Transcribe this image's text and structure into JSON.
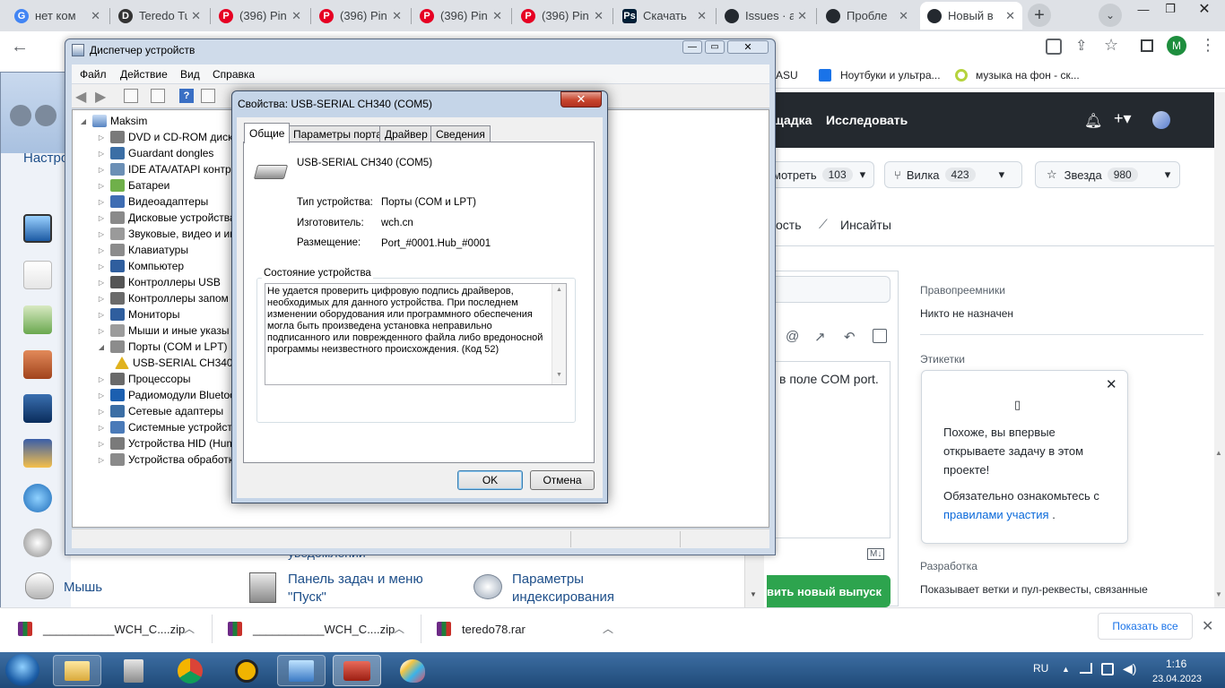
{
  "browser": {
    "tabs": [
      {
        "label": "нет ком",
        "fav": "G",
        "color": "#4285f4"
      },
      {
        "label": "Teredo Tu",
        "fav": "D",
        "color": "#333333"
      },
      {
        "label": "(396) Pin",
        "fav": "P",
        "color": "#e60023"
      },
      {
        "label": "(396) Pin",
        "fav": "P",
        "color": "#e60023"
      },
      {
        "label": "(396) Pin",
        "fav": "P",
        "color": "#e60023"
      },
      {
        "label": "(396) Pin",
        "fav": "P",
        "color": "#e60023"
      },
      {
        "label": "Скачать",
        "fav": "Ps",
        "color": "#001e36"
      },
      {
        "label": "Issues · a",
        "fav": "",
        "color": "#24292f"
      },
      {
        "label": "Пробле",
        "fav": "",
        "color": "#24292f"
      },
      {
        "label": "Новый в",
        "fav": "",
        "color": "#24292f"
      }
    ],
    "bookmarks": [
      "ASU",
      "Ноутбуки и ультра...",
      "музыка на фон - ск..."
    ],
    "profile_initial": "M"
  },
  "github": {
    "nav": [
      "щадка",
      "Исследовать"
    ],
    "watch": {
      "label": "мотреть",
      "count": "103"
    },
    "fork": {
      "label": "Вилка",
      "count": "423"
    },
    "star": {
      "label": "Звезда",
      "count": "980"
    },
    "tabs": [
      "ость",
      "Инсайты"
    ],
    "comment_fragment": "в поле COM port.",
    "sidebar": {
      "assignees_title": "Правопреемники",
      "assignees_value": "Никто не назначен",
      "labels_title": "Этикетки",
      "dev_title": "Разработка",
      "dev_value": "Показывает ветки и пул-реквесты, связанные"
    },
    "popup": {
      "glyph": "▯",
      "line1": "Похоже, вы впервые открываете задачу в этом проекте!",
      "line2": "Обязательно ознакомьтесь с",
      "link": "правилами участия",
      "tail": "."
    },
    "submit_fragment": "вить новый выпуск"
  },
  "controlpanel": {
    "nav_label": "Настро",
    "items": [
      {
        "label": "Мышь"
      },
      {
        "label": "Панель задач и меню \"Пуск\""
      },
      {
        "label": "Параметры индексирования"
      }
    ],
    "hidden_fragment": "уведомлений"
  },
  "devmgr": {
    "title": "Диспетчер устройств",
    "menu": [
      "Файл",
      "Действие",
      "Вид",
      "Справка"
    ],
    "root": "Maksim",
    "nodes": [
      {
        "label": "DVD и CD-ROM дисков",
        "color": "#7a7a7a"
      },
      {
        "label": "Guardant dongles",
        "color": "#3b6ea5"
      },
      {
        "label": "IDE ATA/ATAPI контр",
        "color": "#6b8fb5"
      },
      {
        "label": "Батареи",
        "color": "#6fb04a"
      },
      {
        "label": "Видеоадаптеры",
        "color": "#3f6db3"
      },
      {
        "label": "Дисковые устройства",
        "color": "#8a8a8a"
      },
      {
        "label": "Звуковые, видео и иг",
        "color": "#9a9a9a"
      },
      {
        "label": "Клавиатуры",
        "color": "#8c8c8c"
      },
      {
        "label": "Компьютер",
        "color": "#2f5e9e"
      },
      {
        "label": "Контроллеры USB",
        "color": "#555555"
      },
      {
        "label": "Контроллеры запом",
        "color": "#6a6a6a"
      },
      {
        "label": "Мониторы",
        "color": "#2f5e9e"
      },
      {
        "label": "Мыши и иные указы",
        "color": "#9c9c9c"
      },
      {
        "label": "Порты (COM и LPT)",
        "color": "#8c8c8c"
      },
      {
        "label": "USB-SERIAL CH340",
        "color": "#e0b21e"
      },
      {
        "label": "Процессоры",
        "color": "#6a6a6a"
      },
      {
        "label": "Радиомодули Bluetoo",
        "color": "#1b5fb0"
      },
      {
        "label": "Сетевые адаптеры",
        "color": "#3b6ea5"
      },
      {
        "label": "Системные устройст",
        "color": "#4a7ab8"
      },
      {
        "label": "Устройства HID (Hum",
        "color": "#7a7a7a"
      },
      {
        "label": "Устройства обработк",
        "color": "#8a8a8a"
      }
    ]
  },
  "props": {
    "title": "Свойства: USB-SERIAL CH340 (COM5)",
    "tabs": [
      "Общие",
      "Параметры порта",
      "Драйвер",
      "Сведения"
    ],
    "device_name": "USB-SERIAL CH340 (COM5)",
    "fields": [
      {
        "label": "Тип устройства:",
        "value": "Порты (COM и LPT)"
      },
      {
        "label": "Изготовитель:",
        "value": "wch.cn"
      },
      {
        "label": "Размещение:",
        "value": "Port_#0001.Hub_#0001"
      }
    ],
    "status_group": "Состояние устройства",
    "status_text": "Не удается проверить цифровую подпись драйверов, необходимых для данного устройства. При последнем изменении оборудования или программного обеспечения могла быть произведена установка неправильно подписанного или поврежденного файла либо вредоносной программы неизвестного происхождения. (Код 52)",
    "ok": "OK",
    "cancel": "Отмена"
  },
  "downloads": {
    "items": [
      "___________WCH_C....zip",
      "___________WCH_C....zip",
      "teredo78.rar"
    ],
    "show_all": "Показать все"
  },
  "taskbar": {
    "lang": "RU",
    "time": "1:16",
    "date": "23.04.2023"
  }
}
